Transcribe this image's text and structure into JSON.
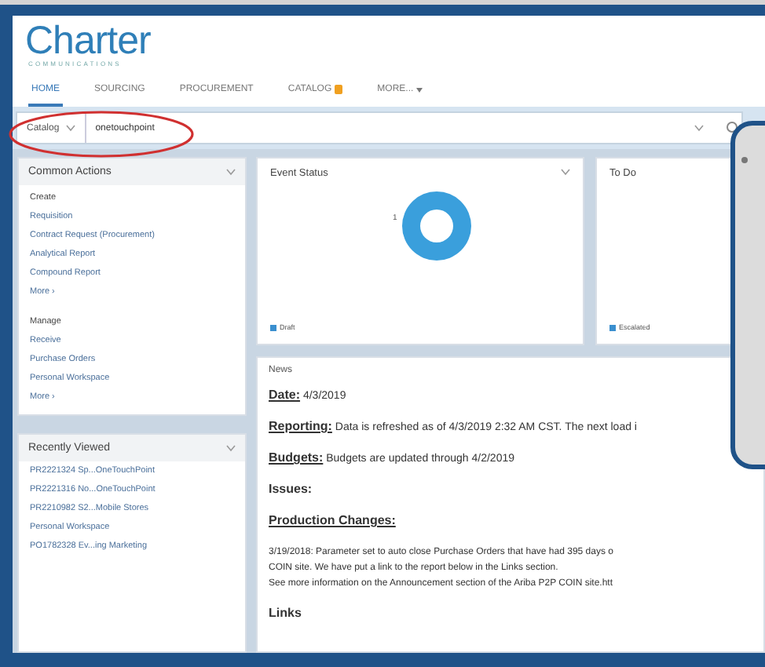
{
  "logo": {
    "name": "Charter",
    "tagline": "COMMUNICATIONS"
  },
  "tabs": [
    {
      "label": "HOME",
      "selected": true,
      "badge": false,
      "dropdown": false
    },
    {
      "label": "SOURCING",
      "selected": false,
      "badge": false,
      "dropdown": false
    },
    {
      "label": "PROCUREMENT",
      "selected": false,
      "badge": false,
      "dropdown": false
    },
    {
      "label": "CATALOG",
      "selected": false,
      "badge": true,
      "dropdown": false
    },
    {
      "label": "MORE...",
      "selected": false,
      "badge": false,
      "dropdown": true
    }
  ],
  "search": {
    "scope": "Catalog",
    "value": "onetouchpoint"
  },
  "common_actions": {
    "title": "Common Actions",
    "sections": [
      {
        "heading": "Create",
        "items": [
          "Requisition",
          "Contract Request (Procurement)",
          "Analytical Report",
          "Compound Report",
          "More ›"
        ]
      },
      {
        "heading": "Manage",
        "items": [
          "Receive",
          "Purchase Orders",
          "Personal Workspace",
          "More ›"
        ]
      }
    ]
  },
  "recently_viewed": {
    "title": "Recently Viewed",
    "items": [
      "PR2221324 Sp...OneTouchPoint",
      "PR2221316 No...OneTouchPoint",
      "PR2210982 S2...Mobile Stores",
      "Personal Workspace",
      "PO1782328 Ev...ing Marketing"
    ]
  },
  "event_status": {
    "title": "Event Status",
    "count": "1",
    "legend": "Draft"
  },
  "to_do": {
    "title": "To Do",
    "legend": "Escalated"
  },
  "news": {
    "title": "News",
    "entries": [
      {
        "label": "Date:",
        "text": "4/3/2019"
      },
      {
        "label": "Reporting:",
        "text": "Data is refreshed as of 4/3/2019 2:32 AM CST.  The next load i"
      },
      {
        "label": "Budgets:",
        "text": "Budgets are updated through 4/2/2019"
      },
      {
        "label": "Issues:"
      },
      {
        "label": "Production Changes:"
      }
    ],
    "paragraph": [
      "3/19/2018:  Parameter set to auto close Purchase Orders that have had 395 days o",
      "COIN site.  We have put a link to the report below in the Links section.",
      "See more information on the Announcement section of the Ariba P2P COIN site.htt"
    ],
    "links_heading": "Links"
  }
}
